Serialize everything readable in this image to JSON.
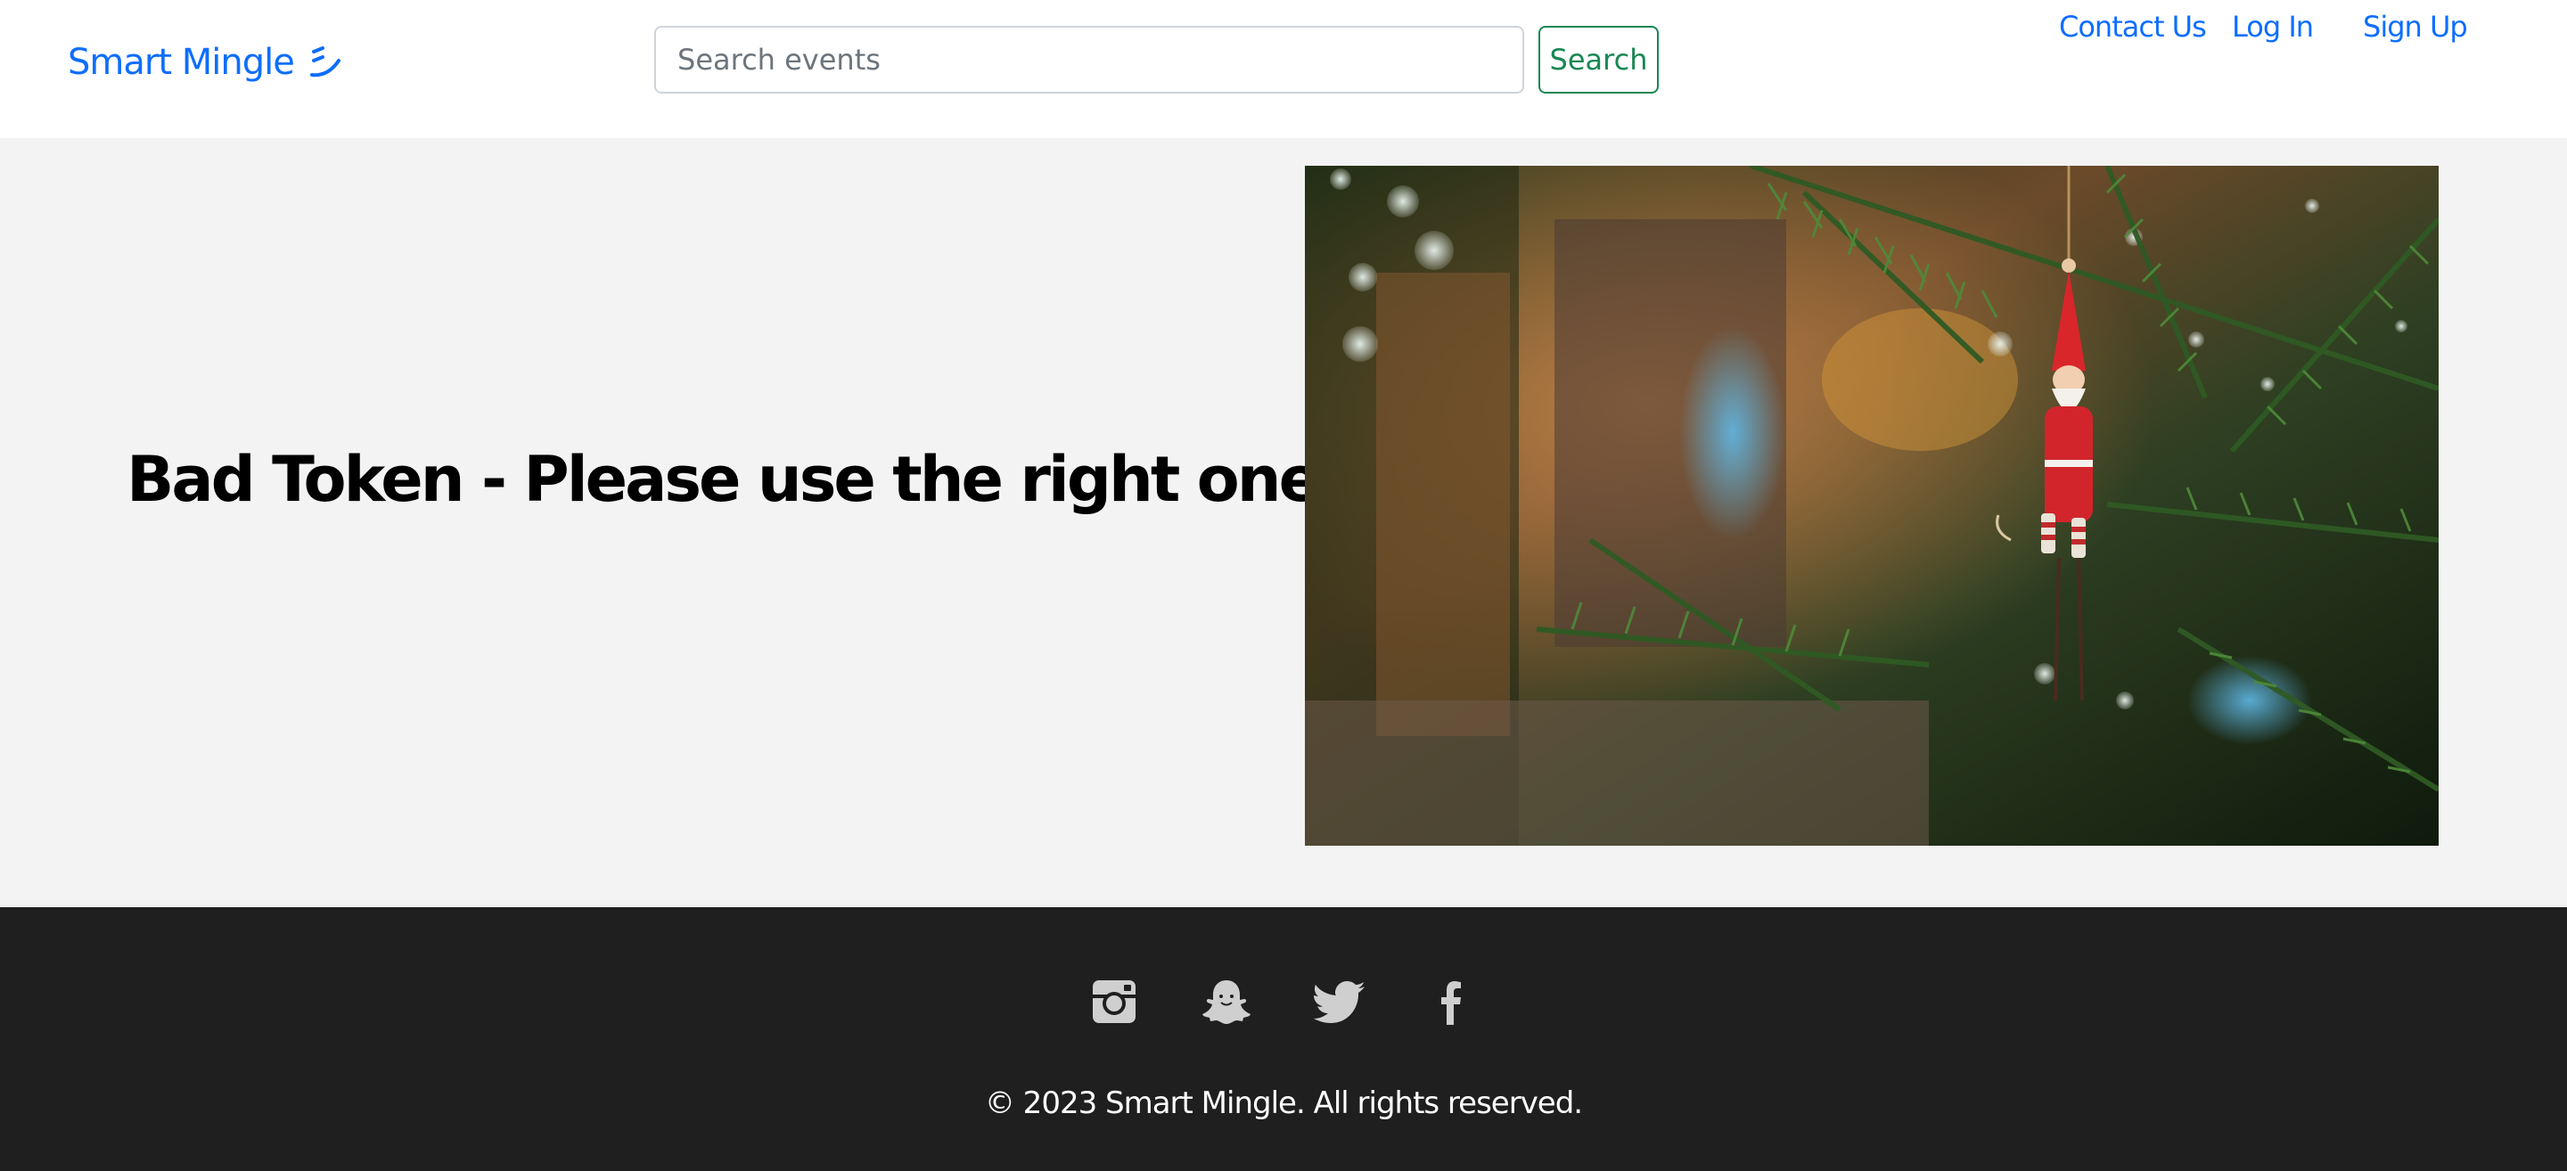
{
  "header": {
    "brand": "Smart Mingle",
    "brand_icon": "smile-wink-icon",
    "search": {
      "placeholder": "Search events",
      "value": ""
    },
    "search_button": "Search",
    "nav": {
      "contact": "Contact Us",
      "login": "Log In",
      "signup": "Sign Up"
    }
  },
  "main": {
    "message": "Bad Token - Please use the right one!",
    "image_subject": "Christmas tree with Santa ornament"
  },
  "footer": {
    "social_icons": [
      "instagram-icon",
      "snapchat-icon",
      "twitter-icon",
      "facebook-icon"
    ],
    "copyright": "© 2023 Smart Mingle. All rights reserved."
  },
  "colors": {
    "link": "#0d6efd",
    "search_button": "#198754",
    "main_bg": "#f3f3f3",
    "footer_bg": "#1f1f1f",
    "footer_icon": "#cfcfcf"
  }
}
